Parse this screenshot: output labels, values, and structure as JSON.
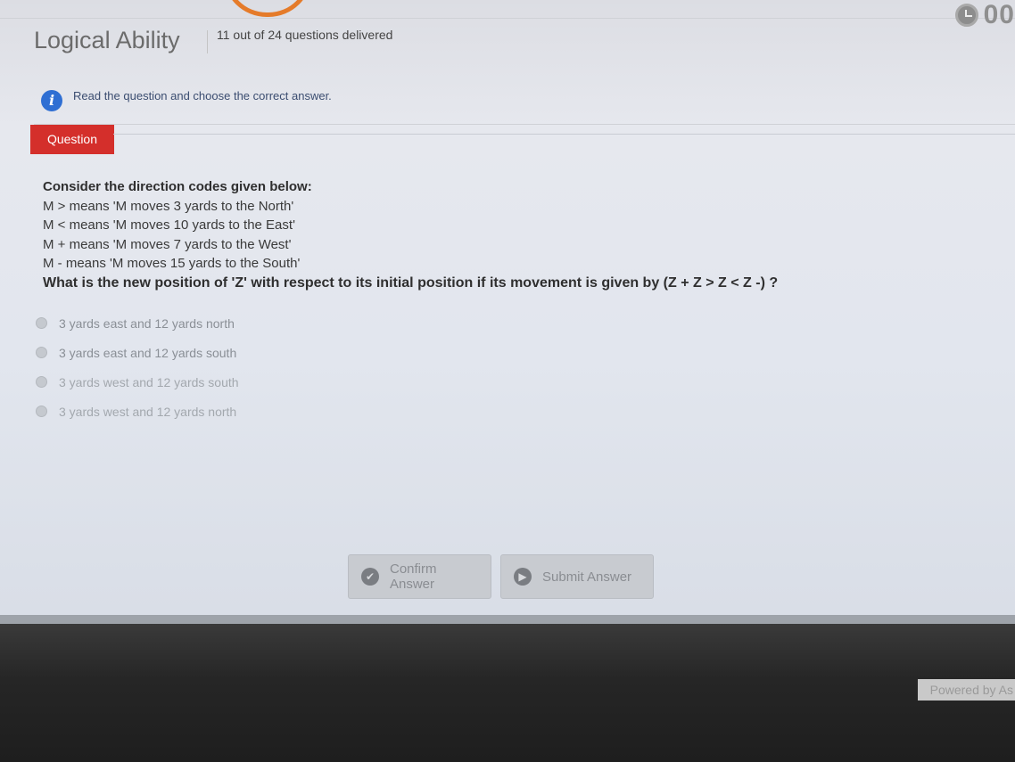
{
  "header": {
    "title": "Logical Ability",
    "progress": "11 out of 24 questions delivered",
    "timer": "00"
  },
  "instruction": "Read the question and choose the correct answer.",
  "question_tab": "Question",
  "question": {
    "intro": "Consider the direction codes given below:",
    "codes": [
      "M > means 'M moves 3 yards to the North'",
      "M < means 'M moves 10 yards to the East'",
      "M + means 'M moves 7 yards to the West'",
      "M - means 'M moves 15 yards to the South'"
    ],
    "ask": "What is the new position of 'Z' with respect to its initial position if its movement is given by (Z + Z > Z < Z -) ?"
  },
  "options": [
    "3 yards east and 12 yards north",
    "3 yards east and 12 yards south",
    "3 yards west and 12 yards south",
    "3 yards west and 12 yards north"
  ],
  "buttons": {
    "confirm": "Confirm Answer",
    "submit": "Submit Answer"
  },
  "footer": {
    "powered_by": "Powered by As"
  },
  "colors": {
    "question_tab": "#d42f2b",
    "info_icon": "#2f6fd3",
    "logo_accent": "#e57b2a"
  }
}
